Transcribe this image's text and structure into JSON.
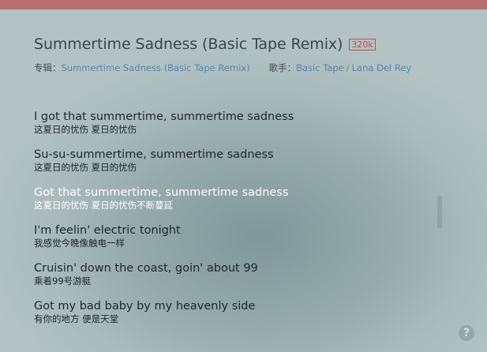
{
  "song": {
    "title": "Summertime Sadness (Basic Tape Remix)",
    "quality_badge": "320k"
  },
  "meta": {
    "album_label": "专辑：",
    "album_name": "Summertime Sadness (Basic Tape Remix)",
    "artist_label": "歌手：",
    "artists": [
      "Basic Tape",
      "Lana Del Rey"
    ],
    "artist_separator": "/"
  },
  "lyrics": [
    {
      "en": "I got that summertime, summertime sadness",
      "zh": "这夏日的忧伤  夏日的忧伤",
      "active": false
    },
    {
      "en": "Su-su-summertime, summertime sadness",
      "zh": "这夏日的忧伤  夏日的忧伤",
      "active": false
    },
    {
      "en": "Got that summertime, summertime sadness",
      "zh": "这夏日的忧伤  夏日的忧伤不断蔓延",
      "active": true
    },
    {
      "en": "I'm feelin' electric tonight",
      "zh": "我感觉今晚像触电一样",
      "active": false
    },
    {
      "en": "Cruisin' down the coast, goin' about 99",
      "zh": "乘着99号游艇",
      "active": false
    },
    {
      "en": "Got my bad baby by my heavenly side",
      "zh": "有你的地方  便是天堂",
      "active": false
    }
  ],
  "help": {
    "symbol": "?"
  },
  "colors": {
    "topbar": "#b96c6c",
    "badge": "#c8494b",
    "link": "#4f88b6",
    "active_lyric": "#ffffff"
  }
}
